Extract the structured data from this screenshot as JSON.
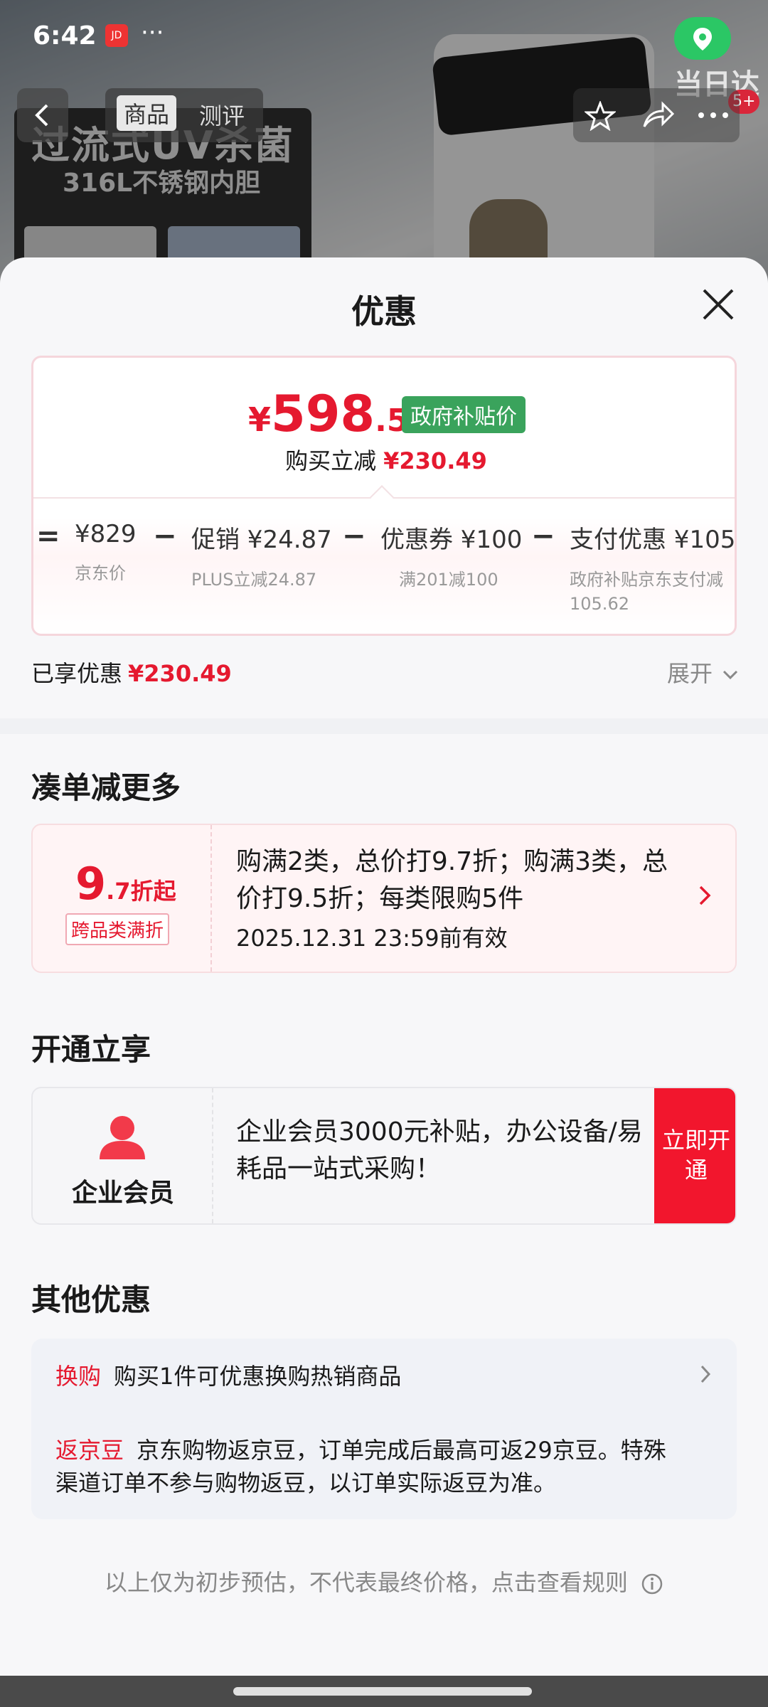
{
  "status_bar": {
    "time": "6:42",
    "app_badge": "JD",
    "more": "···"
  },
  "background": {
    "tabs": [
      "商品",
      "测评"
    ],
    "promo_line1": "过流式UV杀菌",
    "promo_line2": "316L不锈钢内胆",
    "same_day": "当日达",
    "cart_badge": "5+"
  },
  "sheet": {
    "title": "优惠",
    "price": {
      "currency": "¥",
      "integer": "598",
      "decimal": ".51",
      "tag": "政府补贴价"
    },
    "save": {
      "label": "购买立减",
      "amount": "¥230.49"
    },
    "calc": {
      "equals": "=",
      "minus": "−",
      "items": [
        {
          "value": "¥829",
          "sub": "京东价"
        },
        {
          "value": "促销 ¥24.87",
          "sub": "PLUS立减24.87"
        },
        {
          "value": "优惠券 ¥100",
          "sub": "满201减100"
        },
        {
          "value": "支付优惠 ¥105.",
          "sub": "政府补贴京东支付减 105.62"
        }
      ]
    },
    "enjoyed": {
      "label": "已享优惠",
      "amount": "¥230.49"
    },
    "expand_label": "展开",
    "bundle": {
      "section_title": "凑单减更多",
      "big_num": "9",
      "big_rest": ".7折起",
      "tag": "跨品类满折",
      "text": "购满2类，总价打9.7折；购满3类，总价打9.5折；每类限购5件",
      "valid": "2025.12.31 23:59前有效"
    },
    "member": {
      "section_title": "开通立享",
      "name": "企业会员",
      "text": "企业会员3000元补贴，办公设备/易耗品一站式采购！",
      "button": "立即开通"
    },
    "other": {
      "section_title": "其他优惠",
      "exchange_label": "换购",
      "exchange_text": "购买1件可优惠换购热销商品",
      "beans_label": "返京豆",
      "beans_text": "京东购物返京豆，订单完成后最高可返29京豆。特殊渠道订单不参与购物返豆，以订单实际返豆为准。"
    },
    "footnote": "以上仅为初步预估，不代表最终价格，点击查看规则"
  },
  "colors": {
    "accent_red": "#e5192f",
    "gov_green": "#3aa35c",
    "location_green": "#2bc765"
  }
}
